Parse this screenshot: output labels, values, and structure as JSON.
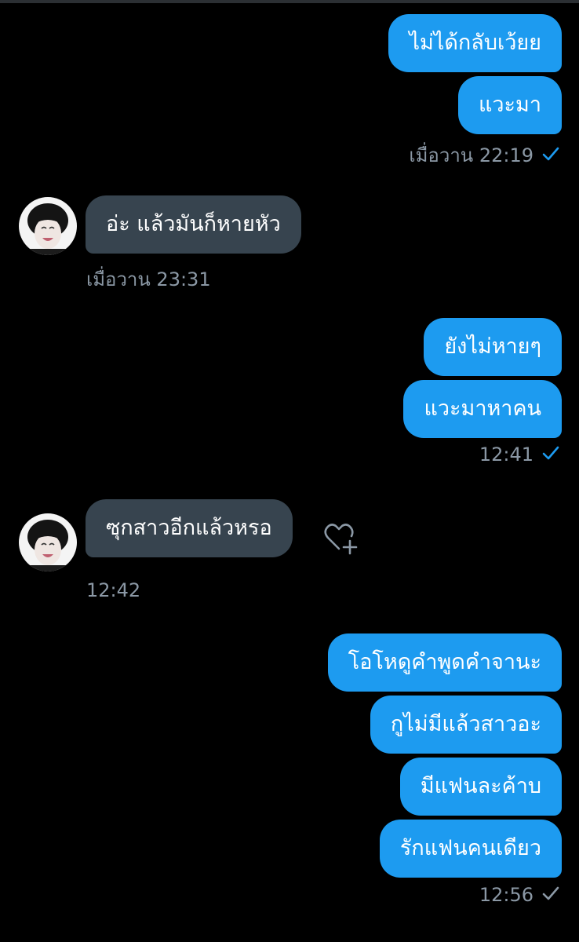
{
  "colors": {
    "background": "#000000",
    "outgoing_bubble": "#1d9bf0",
    "incoming_bubble": "#37444f",
    "meta_text": "#8b98a5",
    "check_read": "#1d9bf0",
    "check_sent": "#8b98a5"
  },
  "groups": [
    {
      "messages": [
        "ไม่ได้กลับเว้ยย",
        "แวะมา"
      ],
      "time": "เมื่อวาน 22:19",
      "status_icon": "check-icon-blue"
    },
    {
      "messages": [
        "อ่ะ แล้วมันก็หายหัว"
      ],
      "time": "เมื่อวาน 23:31",
      "avatar_icon": "avatar-photo"
    },
    {
      "messages": [
        "ยังไม่หายๆ",
        "แวะมาหาคน"
      ],
      "time": "12:41",
      "status_icon": "check-icon-blue"
    },
    {
      "messages": [
        "ซุกสาวอีกแล้วหรอ"
      ],
      "time": "12:42",
      "avatar_icon": "avatar-photo",
      "react_icon": "heart-plus-icon"
    },
    {
      "messages": [
        "โอโหดูคำพูดคำจานะ",
        "กูไม่มีแล้วสาวอะ",
        "มีแฟนละค้าบ",
        "รักแฟนคนเดียว"
      ],
      "time": "12:56",
      "status_icon": "check-icon-gray"
    }
  ]
}
